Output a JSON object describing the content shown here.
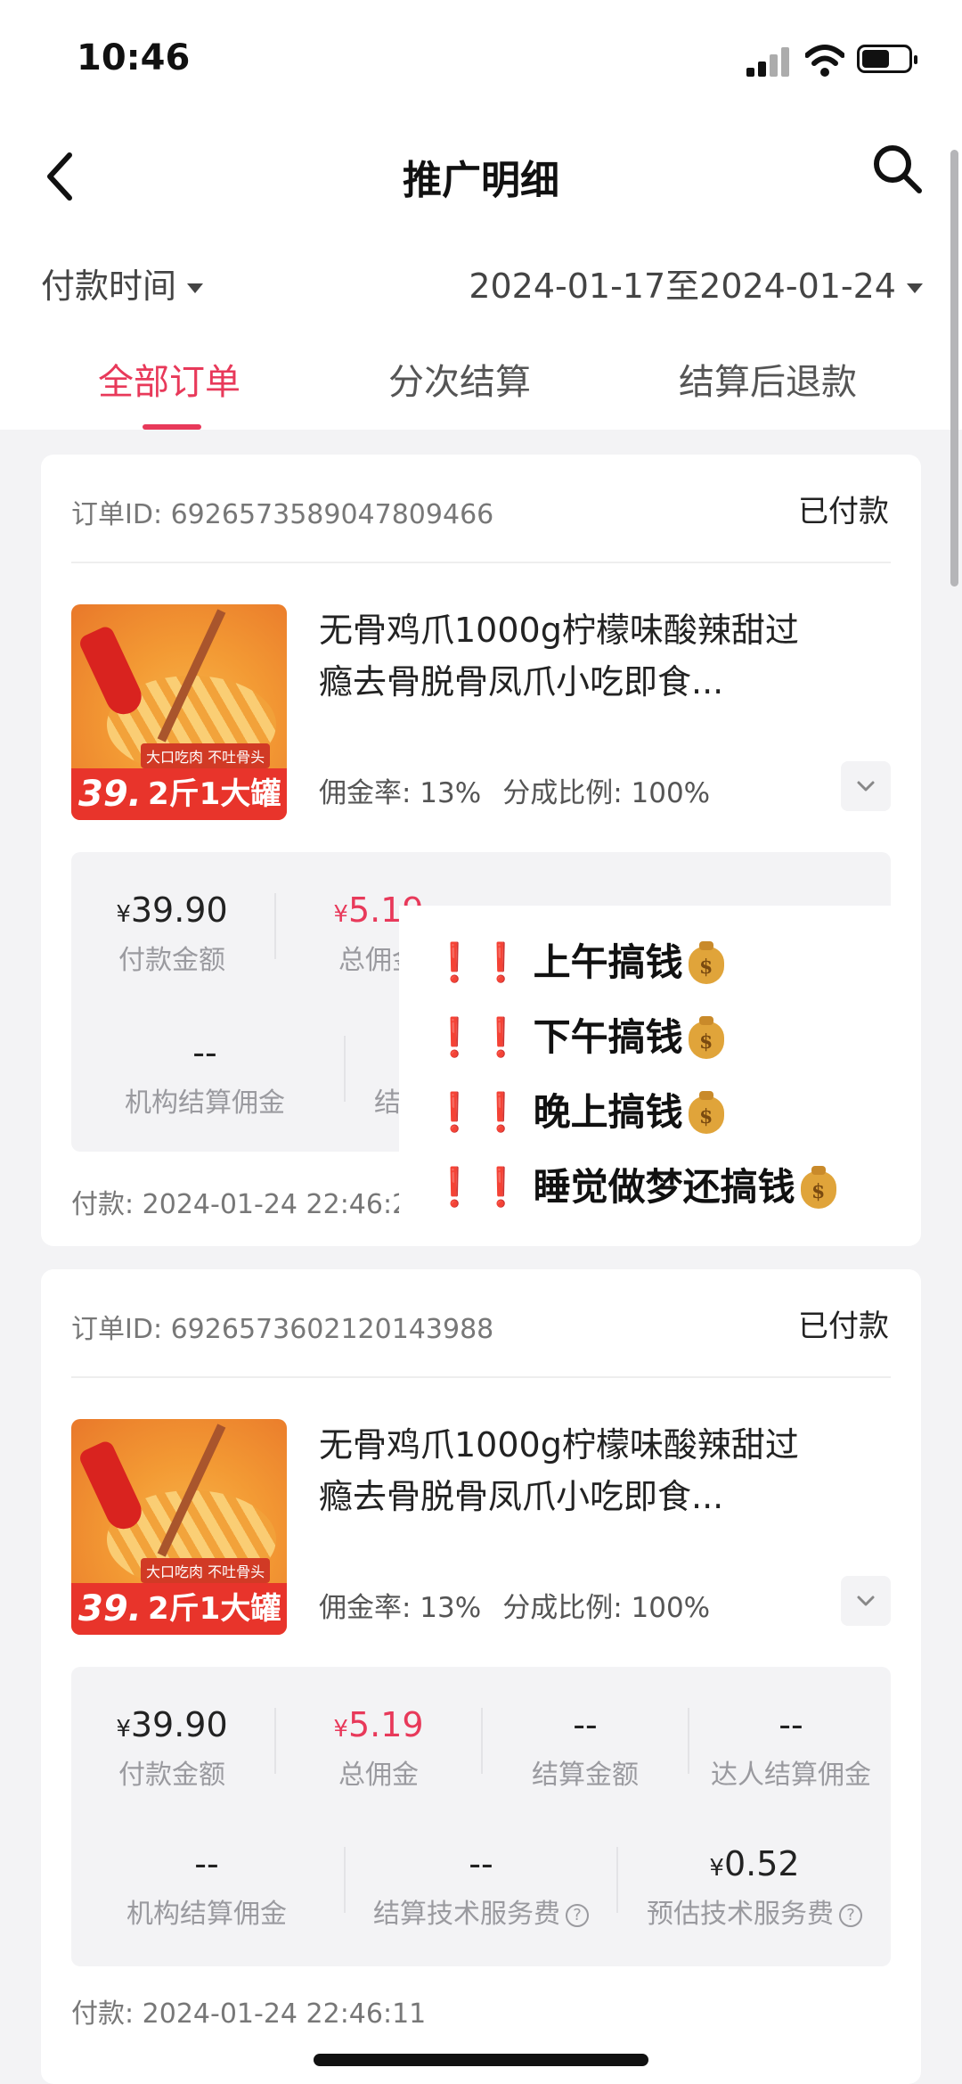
{
  "status_bar": {
    "time": "10:46"
  },
  "nav": {
    "title": "推广明细"
  },
  "filter": {
    "time_type": "付款时间",
    "date_range": "2024-01-17至2024-01-24"
  },
  "tabs": [
    {
      "label": "全部订单",
      "active": true
    },
    {
      "label": "分次结算",
      "active": false
    },
    {
      "label": "结算后退款",
      "active": false
    }
  ],
  "orders": [
    {
      "order_id": "订单ID: 6926573589047809466",
      "status": "已付款",
      "product_name": "无骨鸡爪1000g柠檬味酸辣甜过瘾去骨脱骨凤爪小吃即食...",
      "thumb_price": "39.",
      "thumb_label": "2斤1大罐",
      "thumb_tag": "大口吃肉 不吐骨头",
      "commission_rate": "佣金率: 13%",
      "share_ratio": "分成比例: 100%",
      "stats": [
        {
          "currency": "¥",
          "value": "39.90",
          "label": "付款金额"
        },
        {
          "currency": "¥",
          "value": "5.19",
          "label": "总佣金"
        },
        {
          "value": "--",
          "label": "机构结算佣金"
        },
        {
          "label": "结算"
        }
      ],
      "pay_time": "付款: 2024-01-24 22:46:2"
    },
    {
      "order_id": "订单ID: 6926573602120143988",
      "status": "已付款",
      "product_name": "无骨鸡爪1000g柠檬味酸辣甜过瘾去骨脱骨凤爪小吃即食...",
      "thumb_price": "39.",
      "thumb_label": "2斤1大罐",
      "thumb_tag": "大口吃肉 不吐骨头",
      "commission_rate": "佣金率: 13%",
      "share_ratio": "分成比例: 100%",
      "stats": [
        {
          "currency": "¥",
          "value": "39.90",
          "label": "付款金额"
        },
        {
          "currency": "¥",
          "value": "5.19",
          "label": "总佣金"
        },
        {
          "value": "--",
          "label": "结算金额"
        },
        {
          "value": "--",
          "label": "达人结算佣金"
        },
        {
          "value": "--",
          "label": "机构结算佣金"
        },
        {
          "value": "--",
          "label": "结算技术服务费"
        },
        {
          "currency": "¥",
          "value": "0.52",
          "label": "预估技术服务费"
        }
      ],
      "pay_time": "付款: 2024-01-24 22:46:11"
    }
  ],
  "overlay": {
    "lines": [
      "上午搞钱",
      "下午搞钱",
      "晚上搞钱",
      "睡觉做梦还搞钱"
    ],
    "exclaim": "❗❗",
    "bag_symbol": "$"
  },
  "colors": {
    "accent": "#e8395a",
    "background": "#f3f3f5"
  }
}
